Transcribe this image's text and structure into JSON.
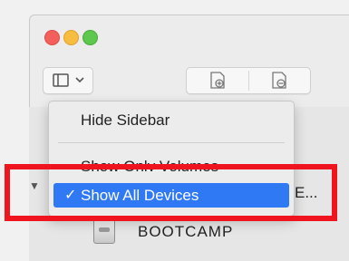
{
  "window": {
    "traffic_lights": [
      "close",
      "minimize",
      "maximize"
    ]
  },
  "toolbar": {
    "sidebar_button_icon": "sidebar-icon",
    "sidebar_button_chevron": "chevron-down-icon",
    "add_volume_icon": "add-volume-icon",
    "remove_volume_icon": "remove-volume-icon"
  },
  "menu": {
    "items": [
      {
        "label": "Hide Sidebar"
      },
      {
        "label": "Show Only Volumes"
      },
      {
        "label": "Show All Devices",
        "checked": true,
        "check_mark": "✓"
      }
    ]
  },
  "sidebar": {
    "partial_text": "E...",
    "volume": {
      "name": "BOOTCAMP",
      "icon": "disk-icon"
    }
  },
  "colors": {
    "highlight": "#2f79f5",
    "annotation_box": "#f0141e"
  }
}
